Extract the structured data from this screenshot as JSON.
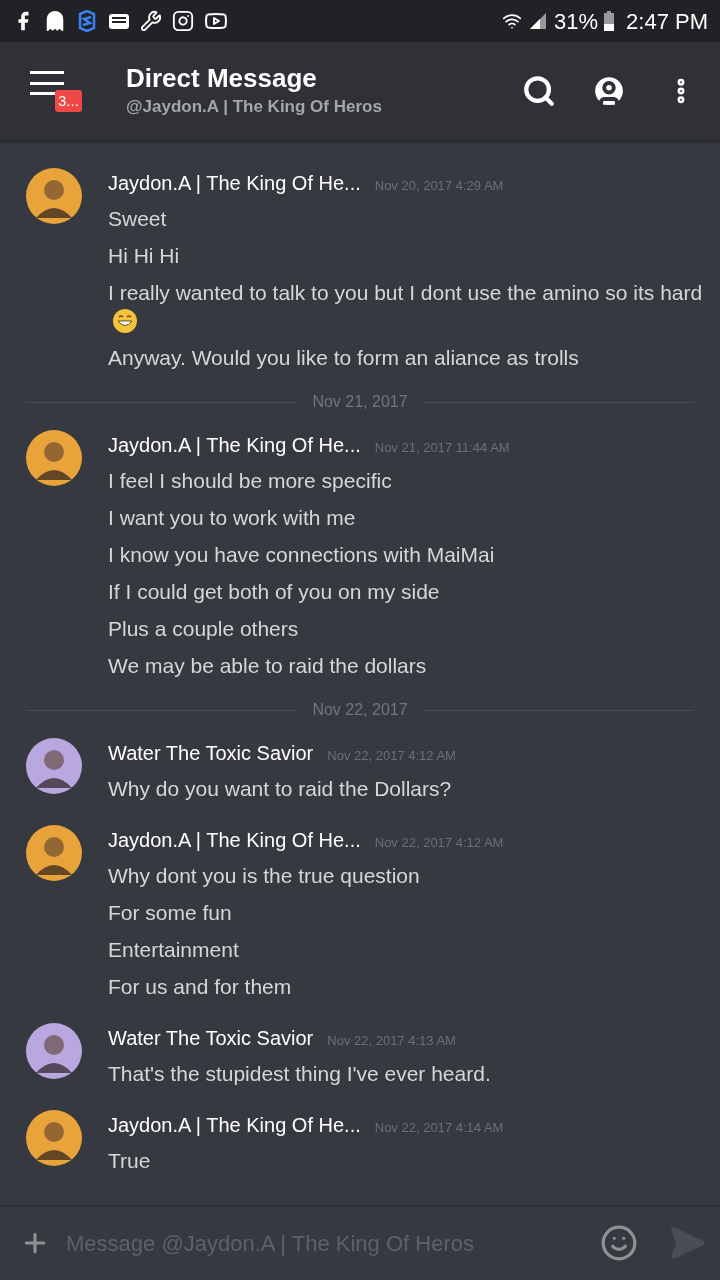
{
  "status_bar": {
    "battery": "31%",
    "time": "2:47 PM"
  },
  "header": {
    "badge": "3...",
    "title": "Direct Message",
    "subtitle": "@Jaydon.A | The King Of Heros"
  },
  "feed": [
    {
      "kind": "group",
      "author": "Jaydon.A | The King Of He...",
      "time": "Nov 20, 2017 4:29 AM",
      "color": "#e8a33a",
      "lines": [
        {
          "text": "Sweet"
        },
        {
          "text": "Hi Hi Hi"
        },
        {
          "text": "I really wanted to talk to you but I dont use the amino so its hard",
          "emoji": true
        },
        {
          "text": "Anyway. Would you like to form an aliance as trolls"
        }
      ]
    },
    {
      "kind": "divider",
      "label": "Nov 21, 2017"
    },
    {
      "kind": "group",
      "author": "Jaydon.A | The King Of He...",
      "time": "Nov 21, 2017 11:44 AM",
      "color": "#e8a33a",
      "lines": [
        {
          "text": "I feel I should be more specific"
        },
        {
          "text": "I want you to work with me"
        },
        {
          "text": "I know you have connections with MaiMai"
        },
        {
          "text": "If I could get both of you on my side"
        },
        {
          "text": "Plus a couple others"
        },
        {
          "text": "We may be able to raid the dollars"
        }
      ]
    },
    {
      "kind": "divider",
      "label": "Nov 22, 2017"
    },
    {
      "kind": "group",
      "author": "Water The Toxic Savior",
      "time": "Nov 22, 2017 4:12 AM",
      "color": "#b9a8e0",
      "lines": [
        {
          "text": "Why do you want to raid the Dollars?"
        }
      ]
    },
    {
      "kind": "group",
      "author": "Jaydon.A | The King Of He...",
      "time": "Nov 22, 2017 4:12 AM",
      "color": "#e8a33a",
      "lines": [
        {
          "text": "Why dont you is the true question"
        },
        {
          "text": "For some fun"
        },
        {
          "text": "Entertainment"
        },
        {
          "text": "For us and for them"
        }
      ]
    },
    {
      "kind": "group",
      "author": "Water The Toxic Savior",
      "time": "Nov 22, 2017 4:13 AM",
      "color": "#b9a8e0",
      "lines": [
        {
          "text": "That's the stupidest thing I've ever heard."
        }
      ]
    },
    {
      "kind": "group",
      "author": "Jaydon.A | The King Of He...",
      "time": "Nov 22, 2017 4:14 AM",
      "color": "#e8a33a",
      "lines": [
        {
          "text": "True"
        }
      ]
    }
  ],
  "composer": {
    "placeholder": "Message @Jaydon.A | The King Of Heros"
  }
}
